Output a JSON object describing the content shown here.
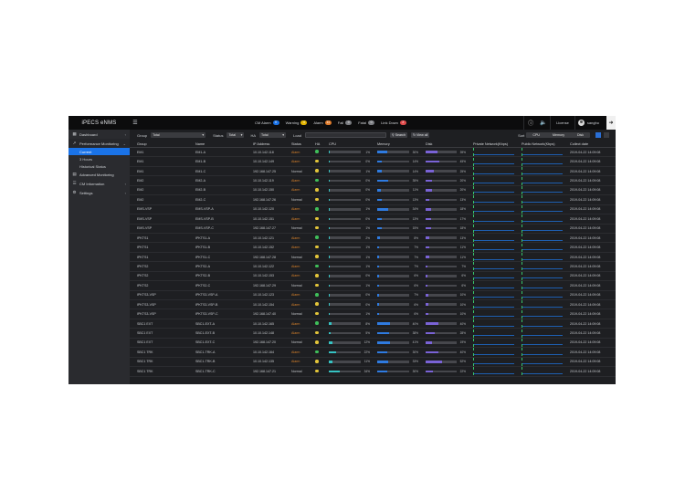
{
  "app": {
    "title": "iPECS eNMS"
  },
  "topbar": {
    "counters": [
      {
        "label": "CM Alarm",
        "value": "0",
        "color": "#1a73e8"
      },
      {
        "label": "Warning",
        "value": "4",
        "color": "#e3b400"
      },
      {
        "label": "Alarm",
        "value": "11",
        "color": "#e07b2b"
      },
      {
        "label": "Fail",
        "value": "0",
        "color": "#7b7d82"
      },
      {
        "label": "Fatal",
        "value": "0",
        "color": "#7b7d82"
      },
      {
        "label": "Link Down",
        "value": "2",
        "color": "#e04b4b"
      }
    ],
    "license_label": "License",
    "user_name": "sangho"
  },
  "sidebar": {
    "dashboard": "Dashboard",
    "performance": "Performance Monitoring",
    "sub_current": "Current",
    "sub_3hours": "3 Hours",
    "sub_history": "Historical Status",
    "advanced": "Advanced Monitoring",
    "cm_info": "CM Information",
    "settings": "Settings"
  },
  "filters": {
    "group_label": "Group",
    "group_value": "Total",
    "status_label": "Status",
    "status_value": "Total",
    "ha_label": "HA",
    "ha_value": "Total",
    "load_label": "Load",
    "search_btn": "Search",
    "viewall_btn": "View all",
    "sort_label": "Sort",
    "sort_cpu": "CPU",
    "sort_memory": "Memory",
    "sort_disk": "Disk"
  },
  "table": {
    "headers": [
      "Group",
      "Name",
      "IP Address",
      "Status",
      "HA",
      "CPU",
      "Memory",
      "Disk",
      "Private Network(Kbps)",
      "Public Network(Kbps)",
      "Collect date"
    ],
    "rows": [
      {
        "group": "EM1",
        "name": "EM1-A",
        "ip": "10.10.142.118",
        "status": "Alarm",
        "ha": "#3fbf5a",
        "cpu": 1,
        "mem": 30,
        "disk": 39,
        "date": "2019-04-22 14:09:08"
      },
      {
        "group": "EM1",
        "name": "EM1-B",
        "ip": "10.10.142.149",
        "status": "Alarm",
        "ha": "#e3c53a",
        "cpu": 0,
        "mem": 14,
        "disk": 45,
        "date": "2019-04-22 14:09:08"
      },
      {
        "group": "EM1",
        "name": "EM1-C",
        "ip": "192.168.147.25",
        "status": "Normal",
        "ha": "#e3c53a",
        "cpu": 1,
        "mem": 14,
        "disk": 25,
        "date": "2019-04-22 14:09:08"
      },
      {
        "group": "EM2",
        "name": "EM2-A",
        "ip": "10.10.142.119",
        "status": "Alarm",
        "ha": "#3fbf5a",
        "cpu": 0,
        "mem": 35,
        "disk": 20,
        "date": "2019-04-22 14:09:08"
      },
      {
        "group": "EM2",
        "name": "EM2-B",
        "ip": "10.10.142.150",
        "status": "Alarm",
        "ha": "#e3c53a",
        "cpu": 0,
        "mem": 11,
        "disk": 20,
        "date": "2019-04-22 14:09:08"
      },
      {
        "group": "EM2",
        "name": "EM2-C",
        "ip": "192.168.147.26",
        "status": "Normal",
        "ha": "#e3c53a",
        "cpu": 0,
        "mem": 13,
        "disk": 13,
        "date": "2019-04-22 14:09:08"
      },
      {
        "group": "EMS-VSP",
        "name": "EMS-VSP-A",
        "ip": "10.10.142.120",
        "status": "Alarm",
        "ha": "#3fbf5a",
        "cpu": 1,
        "mem": 34,
        "disk": 18,
        "date": "2019-04-22 14:09:08"
      },
      {
        "group": "EMS-VSP",
        "name": "EMS-VSP-B",
        "ip": "10.10.142.151",
        "status": "Alarm",
        "ha": "#e3c53a",
        "cpu": 0,
        "mem": 13,
        "disk": 17,
        "date": "2019-04-22 14:09:08"
      },
      {
        "group": "EMS-VSP",
        "name": "EMS-VSP-C",
        "ip": "192.168.147.27",
        "status": "Normal",
        "ha": "#e3c53a",
        "cpu": 1,
        "mem": 15,
        "disk": 18,
        "date": "2019-04-22 14:09:08"
      },
      {
        "group": "IPKTS1",
        "name": "IPKTS1-A",
        "ip": "10.10.142.121",
        "status": "Alarm",
        "ha": "#3fbf5a",
        "cpu": 2,
        "mem": 8,
        "disk": 13,
        "date": "2019-04-22 14:09:08"
      },
      {
        "group": "IPKTS1",
        "name": "IPKTS1-B",
        "ip": "10.10.142.152",
        "status": "Alarm",
        "ha": "#e3c53a",
        "cpu": 1,
        "mem": 7,
        "disk": 11,
        "date": "2019-04-22 14:09:08"
      },
      {
        "group": "IPKTS1",
        "name": "IPKTS1-C",
        "ip": "192.168.147.28",
        "status": "Normal",
        "ha": "#e3c53a",
        "cpu": 1,
        "mem": 7,
        "disk": 11,
        "date": "2019-04-22 14:09:08"
      },
      {
        "group": "IPKTS2",
        "name": "IPKTS2-A",
        "ip": "10.10.142.122",
        "status": "Alarm",
        "ha": "#3fbf5a",
        "cpu": 1,
        "mem": 7,
        "disk": 7,
        "date": "2019-04-22 14:09:08"
      },
      {
        "group": "IPKTS2",
        "name": "IPKTS2-B",
        "ip": "10.10.142.153",
        "status": "Alarm",
        "ha": "#e3c53a",
        "cpu": 0,
        "mem": 6,
        "disk": 6,
        "date": "2019-04-22 14:09:08"
      },
      {
        "group": "IPKTS2",
        "name": "IPKTS2-C",
        "ip": "192.168.147.29",
        "status": "Normal",
        "ha": "#e3c53a",
        "cpu": 1,
        "mem": 6,
        "disk": 6,
        "date": "2019-04-22 14:09:08"
      },
      {
        "group": "IPKTS3-VSP",
        "name": "IPKTS3-VSP-A",
        "ip": "10.10.142.123",
        "status": "Alarm",
        "ha": "#3fbf5a",
        "cpu": 0,
        "mem": 7,
        "disk": 10,
        "date": "2019-04-22 14:09:08"
      },
      {
        "group": "IPKTS3-VSP",
        "name": "IPKTS3-VSP-B",
        "ip": "10.10.142.154",
        "status": "Alarm",
        "ha": "#e3c53a",
        "cpu": 0,
        "mem": 6,
        "disk": 10,
        "date": "2019-04-22 14:09:08"
      },
      {
        "group": "IPKTS3-VSP",
        "name": "IPKTS3-VSP-C",
        "ip": "192.168.147.40",
        "status": "Normal",
        "ha": "#e3c53a",
        "cpu": 1,
        "mem": 6,
        "disk": 10,
        "date": "2019-04-22 14:09:08"
      },
      {
        "group": "SBC1 EXT",
        "name": "SBC1-EXT-A",
        "ip": "10.10.142.165",
        "status": "Alarm",
        "ha": "#3fbf5a",
        "cpu": 8,
        "mem": 40,
        "disk": 40,
        "date": "2019-04-22 14:09:08"
      },
      {
        "group": "SBC1 EXT",
        "name": "SBC1-EXT-B",
        "ip": "10.10.142.148",
        "status": "Alarm",
        "ha": "#e3c53a",
        "cpu": 5,
        "mem": 38,
        "disk": 28,
        "date": "2019-04-22 14:09:08"
      },
      {
        "group": "SBC1 EXT",
        "name": "SBC1-EXT-C",
        "ip": "192.168.147.20",
        "status": "Normal",
        "ha": "#e3c53a",
        "cpu": 12,
        "mem": 41,
        "disk": 19,
        "date": "2019-04-22 14:09:08"
      },
      {
        "group": "SBC1 TRK",
        "name": "SBC1-TRK-A",
        "ip": "10.10.142.164",
        "status": "Alarm",
        "ha": "#3fbf5a",
        "cpu": 22,
        "mem": 30,
        "disk": 40,
        "date": "2019-04-22 14:09:08"
      },
      {
        "group": "SBC1 TRK",
        "name": "SBC1-TRK-B",
        "ip": "10.10.142.135",
        "status": "Alarm",
        "ha": "#e3c53a",
        "cpu": 11,
        "mem": 33,
        "disk": 52,
        "date": "2019-04-22 14:09:08"
      },
      {
        "group": "SBC1 TRK",
        "name": "SBC1-TRK-C",
        "ip": "192.168.147.21",
        "status": "Normal",
        "ha": "#e3c53a",
        "cpu": 34,
        "mem": 30,
        "disk": 22,
        "date": "2019-04-22 14:09:08"
      }
    ]
  },
  "colors": {
    "cpu_bar": "#36c2c2",
    "mem_bar": "#2f7be0",
    "disk_bar": "#7a63d6",
    "alarm": "#d9822b",
    "accent": "#1a73e8"
  }
}
